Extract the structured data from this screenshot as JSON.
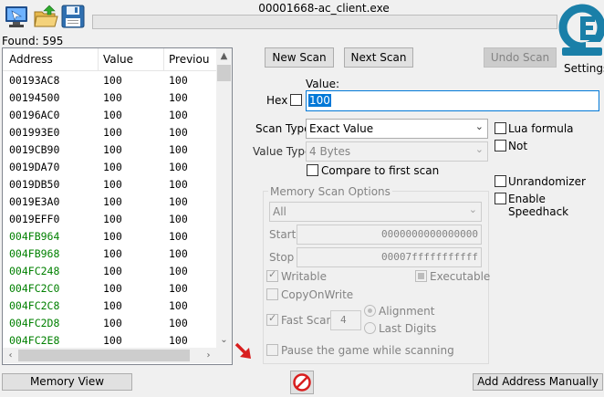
{
  "window": {
    "title": "00001668-ac_client.exe"
  },
  "toolbar": {
    "open_process_icon": "computer-icon",
    "open_file_icon": "open-folder-icon",
    "save_icon": "floppy-save-icon"
  },
  "logo": {
    "label": "Settings",
    "icon": "cheat-engine-logo"
  },
  "found": "Found: 595",
  "results": {
    "headers": [
      "Address",
      "Value",
      "Previou"
    ],
    "rows": [
      {
        "address": "00193AC8",
        "value": "100",
        "previous": "100",
        "color": "#000000"
      },
      {
        "address": "00194500",
        "value": "100",
        "previous": "100",
        "color": "#000000"
      },
      {
        "address": "00196AC0",
        "value": "100",
        "previous": "100",
        "color": "#000000"
      },
      {
        "address": "001993E0",
        "value": "100",
        "previous": "100",
        "color": "#000000"
      },
      {
        "address": "0019CB90",
        "value": "100",
        "previous": "100",
        "color": "#000000"
      },
      {
        "address": "0019DA70",
        "value": "100",
        "previous": "100",
        "color": "#000000"
      },
      {
        "address": "0019DB50",
        "value": "100",
        "previous": "100",
        "color": "#000000"
      },
      {
        "address": "0019E3A0",
        "value": "100",
        "previous": "100",
        "color": "#000000"
      },
      {
        "address": "0019EFF0",
        "value": "100",
        "previous": "100",
        "color": "#000000"
      },
      {
        "address": "004FB964",
        "value": "100",
        "previous": "100",
        "color": "#008000"
      },
      {
        "address": "004FB968",
        "value": "100",
        "previous": "100",
        "color": "#008000"
      },
      {
        "address": "004FC248",
        "value": "100",
        "previous": "100",
        "color": "#008000"
      },
      {
        "address": "004FC2C0",
        "value": "100",
        "previous": "100",
        "color": "#008000"
      },
      {
        "address": "004FC2C8",
        "value": "100",
        "previous": "100",
        "color": "#008000"
      },
      {
        "address": "004FC2D8",
        "value": "100",
        "previous": "100",
        "color": "#008000"
      },
      {
        "address": "004FC2E8",
        "value": "100",
        "previous": "100",
        "color": "#008000"
      }
    ]
  },
  "scan_buttons": {
    "new_scan": "New Scan",
    "next_scan": "Next Scan",
    "undo_scan": "Undo Scan"
  },
  "value": {
    "label": "Value:",
    "hex_label": "Hex",
    "current": "100"
  },
  "scan_type": {
    "label": "Scan Type",
    "selected": "Exact Value"
  },
  "value_type": {
    "label": "Value Type",
    "selected": "4 Bytes"
  },
  "compare_first": "Compare to first scan",
  "options_right": {
    "lua_formula": "Lua formula",
    "not": "Not",
    "unrandomizer": "Unrandomizer",
    "enable_speedhack": "Enable Speedhack"
  },
  "memory_options": {
    "title": "Memory Scan Options",
    "region": "All",
    "start_label": "Start",
    "start_value": "0000000000000000",
    "stop_label": "Stop",
    "stop_value": "00007fffffffffff",
    "writable": "Writable",
    "executable": "Executable",
    "copy_on_write": "CopyOnWrite",
    "fast_scan": "Fast Scan",
    "fast_scan_value": "4",
    "alignment": "Alignment",
    "last_digits": "Last Digits",
    "pause_game": "Pause the game while scanning"
  },
  "bottom": {
    "memory_view": "Memory View",
    "add_address": "Add Address Manually"
  },
  "colors": {
    "accent": "#0078d7",
    "changed_address": "#008000",
    "arrow_red": "#d81e1e"
  }
}
